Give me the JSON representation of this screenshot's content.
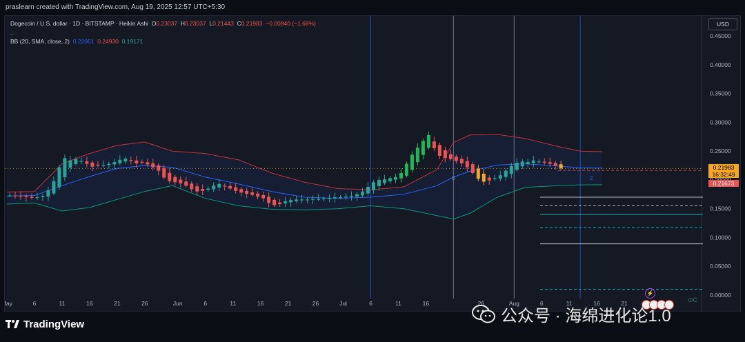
{
  "header": {
    "attribution": "praslearn created with TradingView.com, Aug 19, 2025 12:57 UTC+5:30"
  },
  "legend": {
    "symbol": "Dogecoin / U.S. dollar · 1D · BITSTAMP · Heikin Ashi",
    "o_label": "O",
    "o_value": "0.23037",
    "h_label": "H",
    "h_value": "0.23037",
    "l_label": "L",
    "l_value": "0.21443",
    "c_label": "C",
    "c_value": "0.21983",
    "change": "−0.00840 (−1.68%)",
    "more": "...",
    "bb_label": "BB (20, SMA, close, 2)",
    "bb_basis": "0.22051",
    "bb_upper": "0.24930",
    "bb_lower": "0.19171"
  },
  "toolbar": {
    "currency_button": "USD"
  },
  "price_tags": {
    "last_price": "0.21983",
    "countdown": "16:32:49",
    "secondary_price": "0.21673"
  },
  "colors": {
    "background": "#141923",
    "up": "#26a69a",
    "up_bright": "#1db954",
    "down": "#ef5350",
    "orange": "#f5a623",
    "bb_basis": "#2962ff",
    "bb_upper": "#f23645",
    "bb_lower": "#089981"
  },
  "icons": [
    "tradingview-logo-icon",
    "wechat-icon",
    "lightning-icon",
    "flags-icon"
  ],
  "branding": {
    "logo_text": "TradingView"
  },
  "watermark": {
    "text": "公众号 · 海绵进化论1.0"
  },
  "misc_labels": {
    "ec": "⊙C",
    "marker_0": "0",
    "marker_2": "2"
  },
  "chart_data": {
    "type": "candlestick",
    "title": "Dogecoin / U.S. dollar · 1D · BITSTAMP · Heikin Ashi",
    "xlabel": "",
    "ylabel": "",
    "ylim": [
      -0.03,
      0.485
    ],
    "y_ticks": [
      "0.45000",
      "0.40000",
      "0.35000",
      "0.30000",
      "0.25000",
      "0.20000",
      "0.15000",
      "0.10000",
      "0.05000",
      "0.00000"
    ],
    "y_tick_values": [
      0.45,
      0.4,
      0.35,
      0.3,
      0.25,
      0.2,
      0.15,
      0.1,
      0.05,
      0.0
    ],
    "x_ticks": [
      "May",
      "6",
      "11",
      "16",
      "21",
      "26",
      "Jun",
      "6",
      "11",
      "16",
      "21",
      "26",
      "Jul",
      "6",
      "11",
      "16",
      "26",
      "Aug",
      "6",
      "11",
      "16",
      "21",
      "26"
    ],
    "x_tick_days": [
      0,
      5,
      10,
      15,
      20,
      25,
      31,
      36,
      41,
      46,
      51,
      56,
      61,
      66,
      71,
      76,
      86,
      92,
      97,
      102,
      107,
      112,
      117
    ],
    "vertical_lines_days": [
      66,
      81,
      92,
      104
    ],
    "candles_close": [
      0.173,
      0.172,
      0.171,
      0.17,
      0.169,
      0.17,
      0.172,
      0.182,
      0.198,
      0.222,
      0.238,
      0.234,
      0.236,
      0.233,
      0.228,
      0.223,
      0.225,
      0.226,
      0.228,
      0.231,
      0.235,
      0.237,
      0.233,
      0.229,
      0.23,
      0.227,
      0.222,
      0.216,
      0.204,
      0.198,
      0.196,
      0.194,
      0.19,
      0.184,
      0.18,
      0.181,
      0.185,
      0.19,
      0.193,
      0.189,
      0.185,
      0.181,
      0.178,
      0.176,
      0.174,
      0.171,
      0.168,
      0.16,
      0.156,
      0.158,
      0.163,
      0.165,
      0.166,
      0.166,
      0.166,
      0.167,
      0.167,
      0.168,
      0.169,
      0.17,
      0.17,
      0.171,
      0.172,
      0.175,
      0.18,
      0.188,
      0.196,
      0.2,
      0.201,
      0.203,
      0.205,
      0.212,
      0.228,
      0.244,
      0.256,
      0.268,
      0.278,
      0.255,
      0.242,
      0.238,
      0.236,
      0.233,
      0.229,
      0.222,
      0.212,
      0.202,
      0.197,
      0.199,
      0.203,
      0.208,
      0.216,
      0.224,
      0.23,
      0.232,
      0.231,
      0.234,
      0.232,
      0.23,
      0.228,
      0.225,
      0.22
    ],
    "candle_colors_key": "up if close >= open, down otherwise; orange for emphasized candles",
    "last_price": 0.21983,
    "countdown": "16:32:49",
    "secondary_price": 0.21673,
    "horizontal_levels": [
      {
        "value": 0.17,
        "style": "solid",
        "color": "#e0e3eb"
      },
      {
        "value": 0.155,
        "style": "dashed",
        "color": "#d1d4dc"
      },
      {
        "value": 0.14,
        "style": "solid",
        "color": "#26c6da"
      },
      {
        "value": 0.117,
        "style": "dashed",
        "color": "#26c6da"
      },
      {
        "value": 0.089,
        "style": "solid",
        "color": "#e0e3eb"
      },
      {
        "value": 0.01,
        "style": "dashed",
        "color": "#26c6da"
      },
      {
        "value": 0.2165,
        "style": "dashed",
        "color": "#ef5350"
      }
    ],
    "series": [
      {
        "name": "BB (20, SMA, close, 2)",
        "role": "basis"
      },
      {
        "role": "upper"
      },
      {
        "role": "lower"
      }
    ],
    "bb_upper_pts": [
      [
        0,
        0.179
      ],
      [
        5,
        0.18
      ],
      [
        10,
        0.228
      ],
      [
        15,
        0.246
      ],
      [
        20,
        0.26
      ],
      [
        25,
        0.266
      ],
      [
        30,
        0.25
      ],
      [
        36,
        0.246
      ],
      [
        42,
        0.235
      ],
      [
        48,
        0.212
      ],
      [
        54,
        0.196
      ],
      [
        60,
        0.185
      ],
      [
        66,
        0.183
      ],
      [
        72,
        0.188
      ],
      [
        78,
        0.218
      ],
      [
        81,
        0.265
      ],
      [
        84,
        0.278
      ],
      [
        89,
        0.279
      ],
      [
        94,
        0.272
      ],
      [
        100,
        0.258
      ],
      [
        104,
        0.25
      ],
      [
        108,
        0.249
      ]
    ],
    "bb_basis_pts": [
      [
        0,
        0.172
      ],
      [
        5,
        0.173
      ],
      [
        10,
        0.19
      ],
      [
        15,
        0.206
      ],
      [
        20,
        0.22
      ],
      [
        25,
        0.225
      ],
      [
        30,
        0.222
      ],
      [
        36,
        0.205
      ],
      [
        42,
        0.193
      ],
      [
        48,
        0.18
      ],
      [
        54,
        0.17
      ],
      [
        60,
        0.168
      ],
      [
        66,
        0.17
      ],
      [
        72,
        0.175
      ],
      [
        78,
        0.19
      ],
      [
        81,
        0.205
      ],
      [
        84,
        0.215
      ],
      [
        89,
        0.226
      ],
      [
        94,
        0.228
      ],
      [
        100,
        0.224
      ],
      [
        104,
        0.221
      ],
      [
        108,
        0.2205
      ]
    ],
    "bb_lower_pts": [
      [
        0,
        0.158
      ],
      [
        5,
        0.16
      ],
      [
        10,
        0.146
      ],
      [
        15,
        0.152
      ],
      [
        20,
        0.166
      ],
      [
        25,
        0.18
      ],
      [
        30,
        0.19
      ],
      [
        36,
        0.168
      ],
      [
        42,
        0.155
      ],
      [
        48,
        0.149
      ],
      [
        54,
        0.148
      ],
      [
        60,
        0.15
      ],
      [
        66,
        0.155
      ],
      [
        72,
        0.15
      ],
      [
        78,
        0.138
      ],
      [
        81,
        0.132
      ],
      [
        84,
        0.142
      ],
      [
        89,
        0.17
      ],
      [
        94,
        0.187
      ],
      [
        100,
        0.19
      ],
      [
        104,
        0.1915
      ],
      [
        108,
        0.1917
      ]
    ]
  }
}
